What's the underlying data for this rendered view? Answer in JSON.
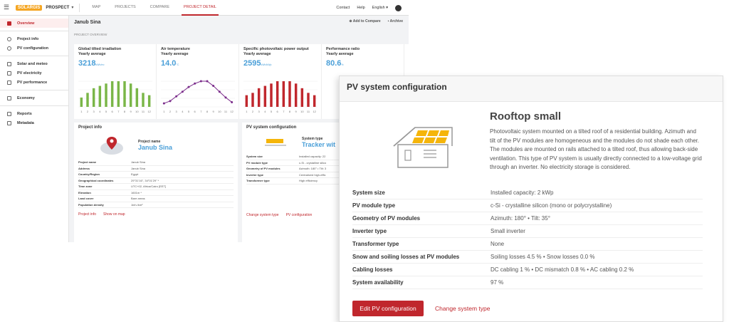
{
  "topbar": {
    "logo": "SOLARGIS",
    "workspace": "PROSPECT",
    "tabs": [
      "MAP",
      "PROJECTS",
      "COMPARE",
      "PROJECT DETAIL"
    ],
    "active_tab": 3,
    "contact": "Contact",
    "help": "Help",
    "language": "English"
  },
  "sidebar": {
    "items": [
      {
        "label": "Overview",
        "icon": "overview-icon",
        "active": true
      },
      {
        "label": "Project info",
        "icon": "compass-icon"
      },
      {
        "label": "PV configuration",
        "icon": "gear-icon"
      },
      {
        "label": "Solar and meteo",
        "icon": "chart-icon"
      },
      {
        "label": "PV electricity",
        "icon": "chart-icon"
      },
      {
        "label": "PV performance",
        "icon": "chart-icon"
      },
      {
        "label": "Economy",
        "icon": "money-icon"
      },
      {
        "label": "Reports",
        "icon": "download-icon"
      },
      {
        "label": "Metadata",
        "icon": "layers-icon"
      }
    ]
  },
  "page": {
    "title": "Janub Sina",
    "add_compare": "Add to Compare",
    "archive": "Archive",
    "section_label": "PROJECT OVERVIEW"
  },
  "cards": [
    {
      "title": "Global tilted irradiation",
      "subtitle": "Yearly average",
      "value": "3218",
      "unit": "kWh/m²",
      "color": "#7ab648",
      "type": "bar",
      "values": [
        4,
        6,
        8,
        9,
        10,
        11,
        11,
        11,
        10,
        8,
        6,
        5
      ]
    },
    {
      "title": "Air temperature",
      "subtitle": "Yearly average",
      "value": "14.0",
      "unit": "°C",
      "color": "#7b2d8b",
      "type": "line",
      "values": [
        3,
        5,
        9,
        13,
        17,
        20,
        22,
        22,
        18,
        13,
        8,
        4
      ]
    },
    {
      "title": "Specific photovoltaic power output",
      "subtitle": "Yearly average",
      "value": "2595",
      "unit": "kWh/kWp",
      "color": "#c0272d",
      "type": "bar",
      "values": [
        5,
        6,
        8,
        9,
        10,
        11,
        11,
        11,
        10,
        8,
        6,
        5
      ]
    },
    {
      "title": "Performance ratio",
      "subtitle": "Yearly average",
      "value": "80.6",
      "unit": "%",
      "color": "#333333",
      "type": "line",
      "values": []
    }
  ],
  "months": [
    "1",
    "2",
    "3",
    "4",
    "5",
    "6",
    "7",
    "8",
    "9",
    "10",
    "11",
    "12"
  ],
  "project_info": {
    "title": "Project info",
    "name_label": "Project name",
    "name": "Janub Sina",
    "rows": [
      {
        "k": "Project name",
        "v": "Janub Sina"
      },
      {
        "k": "Address",
        "v": "Janub Sina"
      },
      {
        "k": "Country/Region",
        "v": "Egypt"
      },
      {
        "k": "Geographical coordinates",
        "v": "29°31'16\", 34°01'29\" *"
      },
      {
        "k": "Time zone",
        "v": "UTC+02, Africa/Cairo [EET]"
      },
      {
        "k": "Elevation",
        "v": "1601m *"
      },
      {
        "k": "Land cover",
        "v": "Bare areas"
      },
      {
        "k": "Population density",
        "v": "1inh./km²"
      }
    ],
    "links": [
      "Project info",
      "Show on map"
    ]
  },
  "pv_small": {
    "title": "PV system configuration",
    "type_label": "System type",
    "type_value": "Tracker wit",
    "rows": [
      {
        "k": "System size",
        "v": "Installed capacity: 22"
      },
      {
        "k": "PV module type",
        "v": "c-Si - crystalline silico"
      },
      {
        "k": "Geometry of PV modules",
        "v": "Azimuth: 180° • Tilt: 3"
      },
      {
        "k": "Inverter type",
        "v": "Centralized high-effic"
      },
      {
        "k": "Transformer type",
        "v": "High efficiency"
      }
    ],
    "links": [
      "Change system type",
      "PV configuration"
    ]
  },
  "panel": {
    "header": "PV system configuration",
    "title": "Rooftop small",
    "description": "Photovoltaic system mounted on a tilted roof of a residential building. Azimuth and tilt of the PV modules are homogeneous and the modules do not shade each other. The modules are mounted on rails attached to a tilted roof, thus allowing back-side ventilation. This type of PV system is usually directly connected to a low-voltage grid through an inverter. No electricity storage is considered.",
    "rows": [
      {
        "k": "System size",
        "v": "Installed capacity: 2 kWp"
      },
      {
        "k": "PV module type",
        "v": "c-Si - crystalline silicon (mono or polycrystalline)"
      },
      {
        "k": "Geometry of PV modules",
        "v": "Azimuth: 180° • Tilt: 35°"
      },
      {
        "k": "Inverter type",
        "v": "Small inverter"
      },
      {
        "k": "Transformer type",
        "v": "None"
      },
      {
        "k": "Snow and soiling losses at PV modules",
        "v": "Soiling losses 4.5 % • Snow losses 0.0 %"
      },
      {
        "k": "Cabling losses",
        "v": "DC cabling 1 % • DC mismatch 0.8 % • AC cabling 0.2 %"
      },
      {
        "k": "System availability",
        "v": "97 %"
      }
    ],
    "edit_button": "Edit PV configuration",
    "change_link": "Change system type"
  }
}
